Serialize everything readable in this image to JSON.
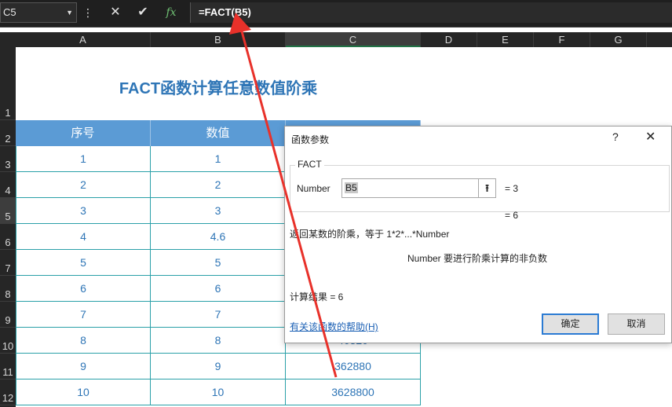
{
  "formula_bar": {
    "name_box": "C5",
    "cancel_icon": "✕",
    "enter_icon": "✔",
    "fx_icon": "fx",
    "formula": "=FACT(B5)"
  },
  "columns": [
    "A",
    "B",
    "C",
    "D",
    "E",
    "F",
    "G"
  ],
  "selected_column": "C",
  "rows": [
    "1",
    "2",
    "3",
    "4",
    "5",
    "6",
    "7",
    "8",
    "9",
    "10",
    "11",
    "12"
  ],
  "selected_row": "5",
  "sheet": {
    "title": "FACT函数计算任意数值阶乘",
    "headers": [
      "序号",
      "数值"
    ],
    "data": [
      {
        "n": "1",
        "v": "1",
        "r": ""
      },
      {
        "n": "2",
        "v": "2",
        "r": ""
      },
      {
        "n": "3",
        "v": "3",
        "r": ""
      },
      {
        "n": "4",
        "v": "4.6",
        "r": ""
      },
      {
        "n": "5",
        "v": "5",
        "r": ""
      },
      {
        "n": "6",
        "v": "6",
        "r": ""
      },
      {
        "n": "7",
        "v": "7",
        "r": ""
      },
      {
        "n": "8",
        "v": "8",
        "r": "40320"
      },
      {
        "n": "9",
        "v": "9",
        "r": "362880"
      },
      {
        "n": "10",
        "v": "10",
        "r": "3628800"
      }
    ],
    "accent_color": "#5b9bd5",
    "text_color": "#2e75b6"
  },
  "dialog": {
    "title": "函数参数",
    "help": "?",
    "close": "✕",
    "function_name": "FACT",
    "arg_label": "Number",
    "arg_value": "B5",
    "arg_ref_icon": "collapse-dialog-icon",
    "arg_result": "=  3",
    "result_preview": "=  6",
    "description": "返回某数的阶乘，等于 1*2*...*Number",
    "arg_description": "Number   要进行阶乘计算的非负数",
    "result": "计算结果 =   6",
    "help_link": "有关该函数的帮助(H)",
    "ok": "确定",
    "cancel": "取消"
  }
}
